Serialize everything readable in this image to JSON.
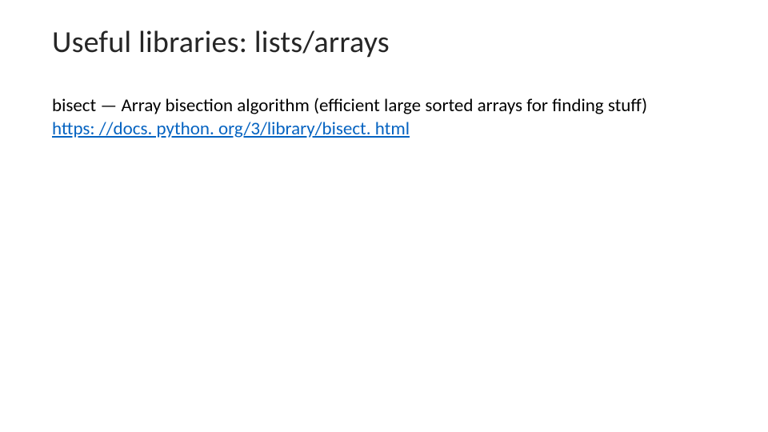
{
  "slide": {
    "title": "Useful libraries: lists/arrays",
    "body_line1": "bisect — Array bisection algorithm (efficient large sorted arrays for finding stuff)",
    "link_text": "https: //docs. python. org/3/library/bisect. html"
  }
}
